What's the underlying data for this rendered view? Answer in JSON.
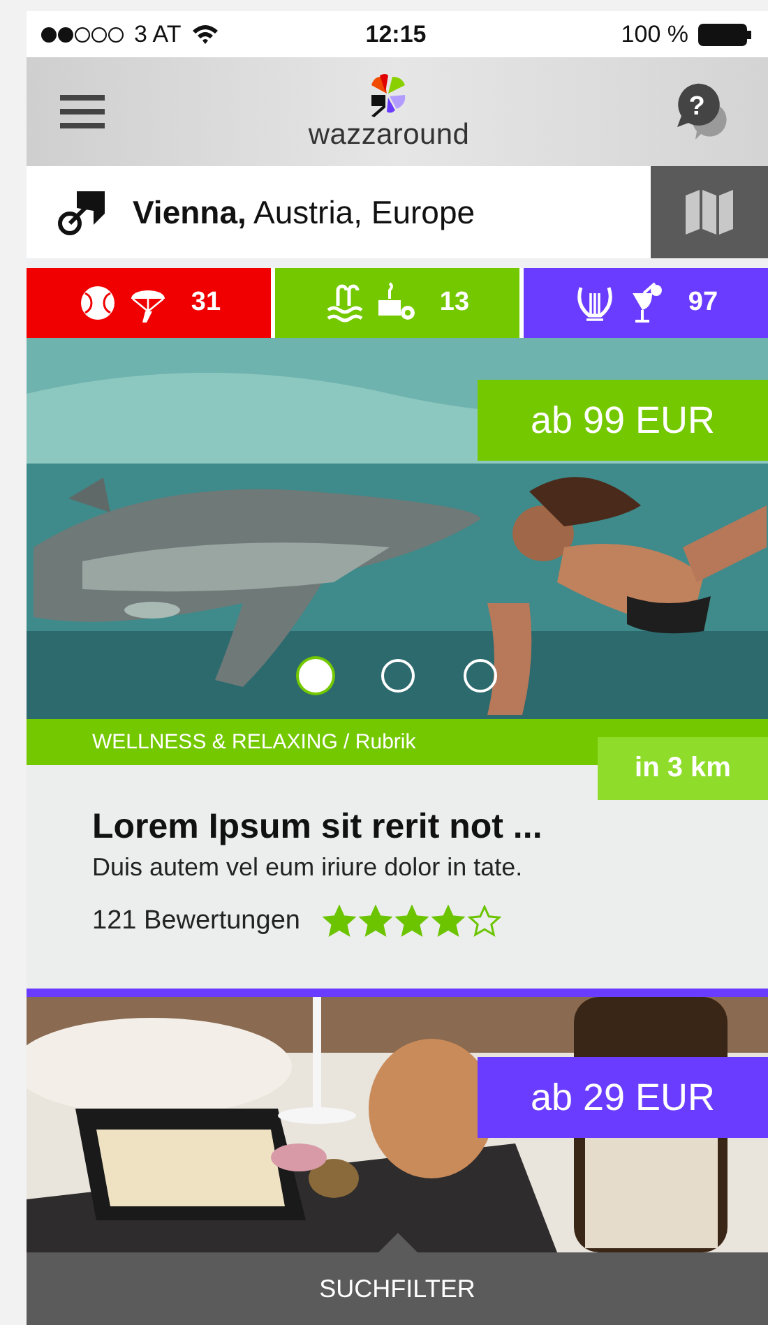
{
  "status_bar": {
    "carrier": "3 AT",
    "time": "12:15",
    "battery": "100 %"
  },
  "header": {
    "logo_text": "wazzaround",
    "help_symbol": "?"
  },
  "location": {
    "city": "Vienna,",
    "region": "Austria, Europe"
  },
  "categories": [
    {
      "kind": "sport",
      "count": "31",
      "color": "#f00000"
    },
    {
      "kind": "wellness",
      "count": "13",
      "color": "#74c800"
    },
    {
      "kind": "nightlife",
      "count": "97",
      "color": "#6a3cff"
    }
  ],
  "cards": [
    {
      "kind": "sea",
      "color": "#74c800",
      "price": "ab 99 EUR",
      "dots": [
        {
          "selected": true
        },
        {
          "selected": false
        },
        {
          "selected": false
        }
      ],
      "category": "WELLNESS & RELAXING / Rubrik",
      "distance": "in 3 km",
      "title": "Lorem Ipsum sit rerit not ...",
      "subtitle": "Duis autem vel eum iriure dolor in tate.",
      "reviews": "121 Bewertungen",
      "stars": 4
    },
    {
      "kind": "food",
      "color": "#6a3cff",
      "price": "ab 29 EUR"
    }
  ],
  "footer": {
    "label": "SUCHFILTER"
  }
}
